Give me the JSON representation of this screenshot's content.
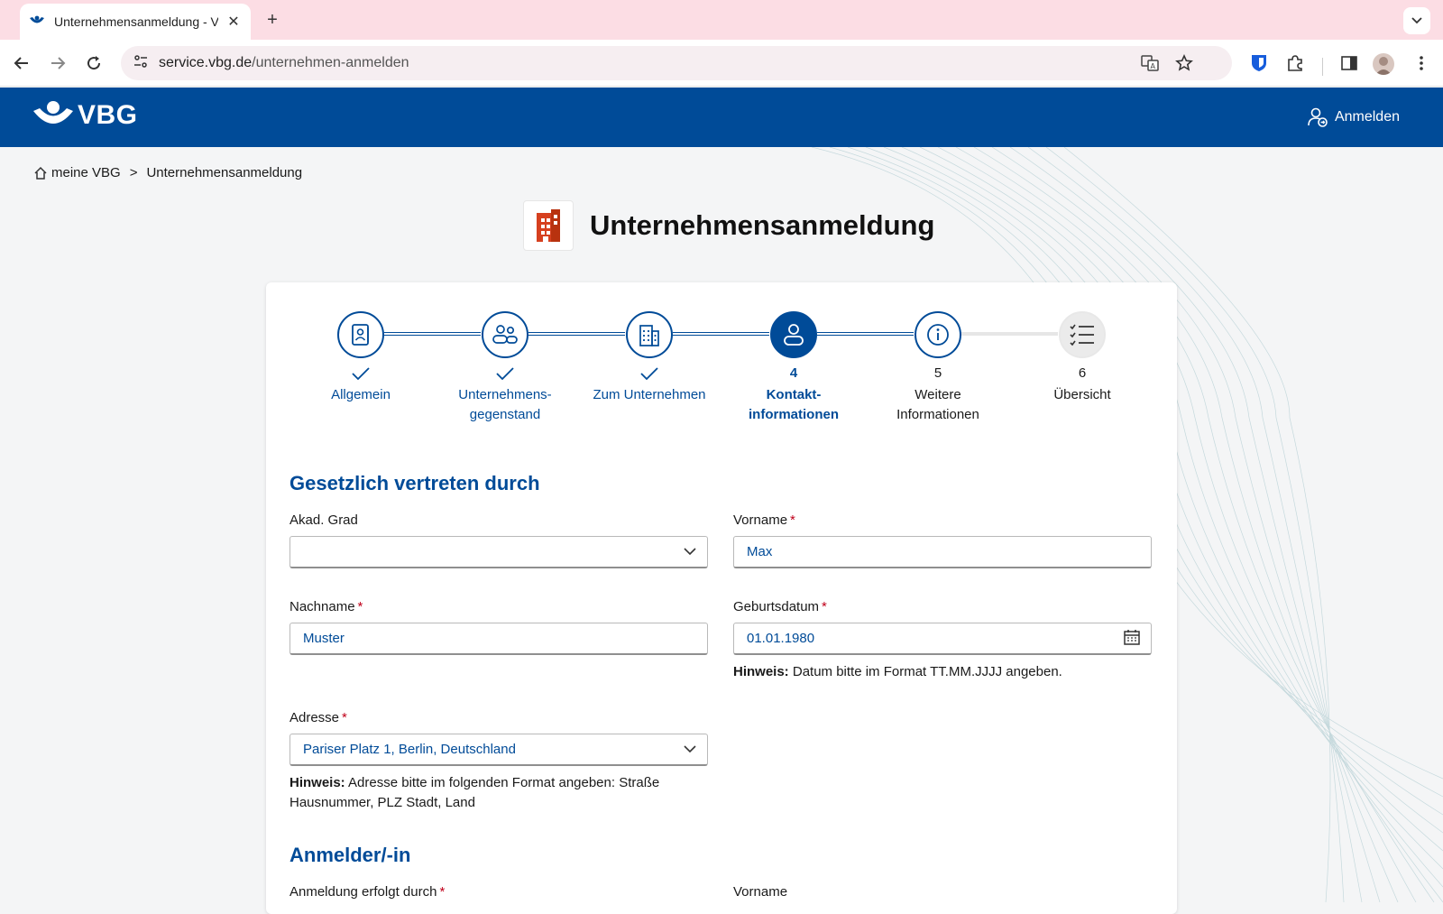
{
  "browser": {
    "tab_title": "Unternehmensanmeldung - VBG",
    "url_host": "service.vbg.de",
    "url_path": "/unternehmen-anmelden"
  },
  "header": {
    "logo_text": "VBG",
    "login_label": "Anmelden",
    "brand_color": "#004b98"
  },
  "breadcrumb": {
    "home": "meine VBG",
    "separator": ">",
    "current": "Unternehmensanmeldung"
  },
  "page": {
    "title": "Unternehmensanmeldung"
  },
  "stepper": {
    "steps": [
      {
        "num": "",
        "label_1": "Allgemein",
        "label_2": "",
        "state": "done"
      },
      {
        "num": "",
        "label_1": "Unternehmens-",
        "label_2": "gegenstand",
        "state": "done"
      },
      {
        "num": "",
        "label_1": "Zum Unternehmen",
        "label_2": "",
        "state": "done"
      },
      {
        "num": "4",
        "label_1": "Kontakt-",
        "label_2": "informationen",
        "state": "active"
      },
      {
        "num": "5",
        "label_1": "Weitere",
        "label_2": "Informationen",
        "state": "next"
      },
      {
        "num": "6",
        "label_1": "Übersicht",
        "label_2": "",
        "state": "pending"
      }
    ]
  },
  "section_legal": {
    "title": "Gesetzlich vertreten durch",
    "akad_grad_label": "Akad. Grad",
    "akad_grad_value": "",
    "vorname_label": "Vorname",
    "vorname_value": "Max",
    "nachname_label": "Nachname",
    "nachname_value": "Muster",
    "geburtsdatum_label": "Geburtsdatum",
    "geburtsdatum_value": "01.01.1980",
    "geburtsdatum_hint_bold": "Hinweis:",
    "geburtsdatum_hint": " Datum bitte im Format TT.MM.JJJJ angeben.",
    "adresse_label": "Adresse",
    "adresse_value": "Pariser Platz 1, Berlin, Deutschland",
    "adresse_hint_bold": "Hinweis:",
    "adresse_hint": " Adresse bitte im folgenden Format angeben: Straße Hausnummer, PLZ Stadt, Land",
    "required_marker": "*"
  },
  "section_applicant": {
    "title": "Anmelder/-in",
    "anmeldung_label": "Anmeldung erfolgt durch",
    "vorname_label": "Vorname"
  }
}
